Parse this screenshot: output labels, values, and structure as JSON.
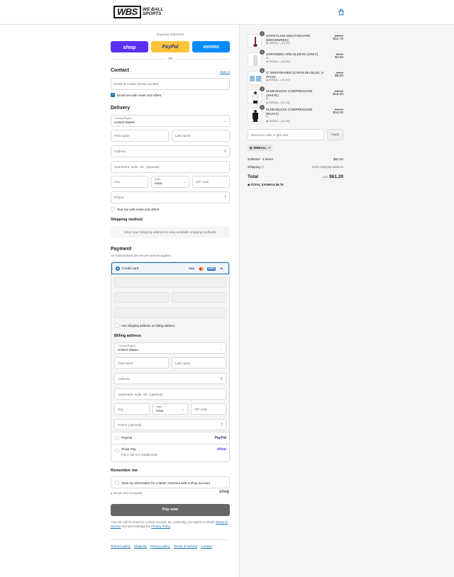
{
  "header": {
    "logo_mark": "WBS",
    "logo_text": "WE BALL SPORTS",
    "cart_icon": "shopping-bag-icon"
  },
  "express": {
    "label": "Express checkout",
    "buttons": [
      {
        "label": "shop",
        "color": "#5a31f4"
      },
      {
        "label": "PayPal",
        "color": "#ffc439"
      },
      {
        "label": "venmo",
        "color": "#008cff"
      }
    ],
    "or": "OR"
  },
  "contact": {
    "title": "Contact",
    "sign_in": "Sign in",
    "email_placeholder": "Email or mobile phone number",
    "news_label": "Email me with news and offers"
  },
  "delivery": {
    "title": "Delivery",
    "country_label": "Country/Region",
    "country_value": "United States",
    "first_name": "First name",
    "last_name": "Last name",
    "address": "Address",
    "apartment": "Apartment, suite, etc. (optional)",
    "city": "City",
    "state_label": "State",
    "state_value": "Iowa",
    "zip": "ZIP code",
    "phone": "Phone",
    "text_me": "Text me with news and offers"
  },
  "shipping_method": {
    "title": "Shipping method",
    "message": "Enter your shipping address to view available shipping methods."
  },
  "payment": {
    "title": "Payment",
    "subtitle": "All transactions are secure and encrypted.",
    "credit_card": "Credit card",
    "cards": [
      "VISA",
      "MC",
      "AMEX",
      "+4"
    ],
    "use_shipping": "Use shipping address as billing address",
    "billing_title": "Billing address",
    "billing": {
      "country_label": "Country/Region",
      "country_value": "United States",
      "first_name": "First name",
      "last_name": "Last name",
      "address": "Address",
      "apartment": "Apartment, suite, etc. (optional)",
      "city": "City",
      "state_label": "State",
      "state_value": "Iowa",
      "zip": "ZIP code",
      "phone": "Phone (optional)"
    },
    "paypal": "PayPal",
    "paypal_logo": "PayPal",
    "shop_pay": "Shop Pay",
    "shop_pay_sub": "Pay in full or in installments",
    "shop_logo": "shop"
  },
  "remember": {
    "title": "Remember me",
    "save_label": "Save my information for a faster checkout with a Shop account",
    "secure": "Secure and encrypted",
    "shop_logo": "shop"
  },
  "pay_now": "Pay now",
  "legal": {
    "text1": "Your info will be saved to a Shop account. By continuing, you agree to Shop's",
    "terms": "Terms of Service",
    "text2": "and acknowledge the",
    "privacy": "Privacy Policy",
    "text3": "."
  },
  "footer": [
    "Refund policy",
    "Shipping",
    "Privacy policy",
    "Terms of service",
    "Contact"
  ],
  "summary": {
    "items": [
      {
        "qty": "1",
        "name": "HYPR-FLOW MOUTHGUARD (BROWN/RED)",
        "variant": "",
        "discount": "WEBALL (-$1.29)",
        "old": "$12.99",
        "price": "$11.70"
      },
      {
        "qty": "1",
        "name": "UNPADDED ARM SLEEVE (GREY)",
        "variant": "XL",
        "discount": "WEBALL (-$0.50)",
        "old": "$5.00",
        "price": "$4.50"
      },
      {
        "qty": "1",
        "name": "3\" WRISTBANDS (CAROLINA BLUE, 2-PACK)",
        "variant": "",
        "discount": "WEBALL (-$0.99)",
        "old": "$9.99",
        "price": "$9.00"
      },
      {
        "qty": "1",
        "name": "SLEEVELESS COMPRESSION (WHITE)",
        "variant": "M",
        "discount": "WEBALL (-$1.99)",
        "old": "$19.99",
        "price": "$18.00"
      },
      {
        "qty": "1",
        "name": "SLEEVELESS COMPRESSION (BLACK)",
        "variant": "S",
        "discount": "WEBALL (-$1.99)",
        "old": "$19.99",
        "price": "$18.00"
      }
    ],
    "discount_placeholder": "Discount code or gift card",
    "apply": "Apply",
    "code_tag": "WEBALL",
    "subtotal_label": "Subtotal · 5 items",
    "subtotal": "$61.20",
    "shipping_label": "Shipping",
    "shipping_value": "Enter shipping address",
    "total_label": "Total",
    "currency": "USD",
    "total": "$61.20",
    "savings_label": "TOTAL SAVINGS",
    "savings": "$6.76"
  }
}
